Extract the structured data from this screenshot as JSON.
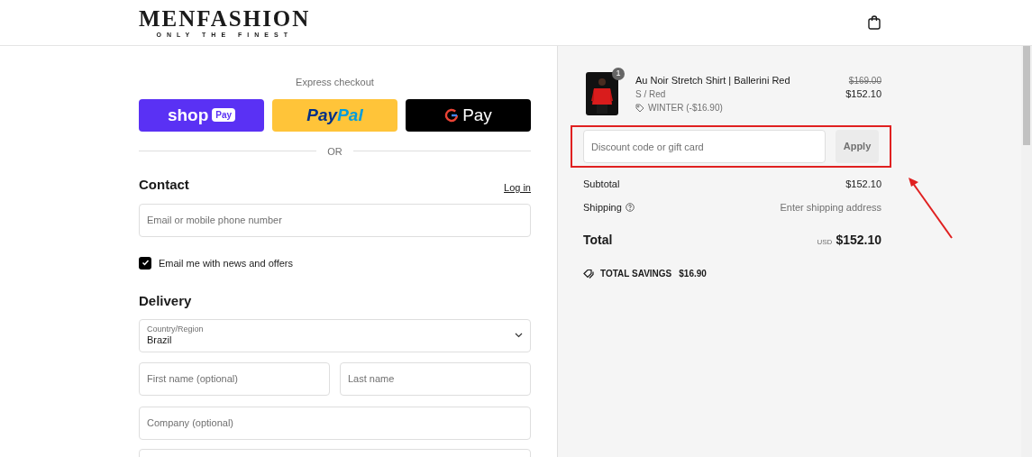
{
  "header": {
    "logo": "MENFASHION",
    "tagline": "ONLY THE FINEST"
  },
  "express_checkout": {
    "title": "Express checkout",
    "buttons": [
      {
        "kind": "shop",
        "label": "shop",
        "badge": "Pay"
      },
      {
        "kind": "paypal",
        "label": "Pay",
        "label_2": "Pal"
      },
      {
        "kind": "gpay",
        "label": "Pay"
      }
    ],
    "separator": "OR"
  },
  "contact": {
    "title": "Contact",
    "link": "Log in",
    "email": {
      "placeholder": "Email or mobile phone number"
    },
    "newsletter": {
      "label": "Email me with news and offers",
      "checked": true
    }
  },
  "delivery": {
    "title": "Delivery",
    "country": {
      "label": "Country/Region",
      "value": "Brazil"
    },
    "fields": [
      {
        "placeholder": "First name (optional)"
      },
      {
        "placeholder": "Last name"
      },
      {
        "placeholder": "Company (optional)"
      }
    ]
  },
  "order": {
    "item": {
      "name": "Au Noir Stretch Shirt | Ballerini Red",
      "quantity": "1",
      "variant": "S / Red",
      "discount": "WINTER (-$16.90)",
      "original_price": "$169.00",
      "price": "$152.10"
    },
    "discount": {
      "placeholder": "Discount code or gift card",
      "button": "Apply"
    },
    "subtotal": {
      "label": "Subtotal",
      "value": "$152.10"
    },
    "shipping": {
      "label": "Shipping",
      "value": "Enter shipping address"
    },
    "total": {
      "label": "Total",
      "currency": "USD",
      "value": "$152.10"
    },
    "savings": {
      "label": "TOTAL SAVINGS",
      "value": "$16.90"
    }
  }
}
